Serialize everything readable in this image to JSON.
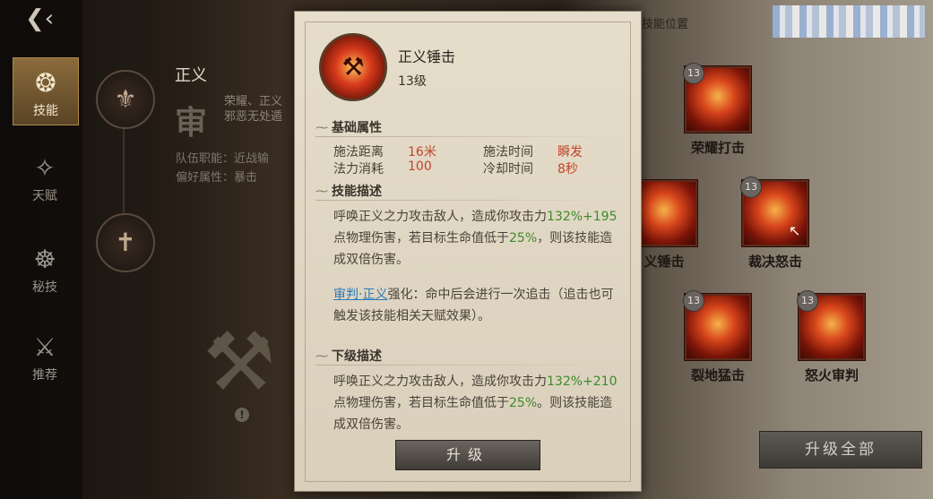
{
  "nav": {
    "back_icon": "back-arrow-icon",
    "items": [
      {
        "label": "技能",
        "icon": "skill-icon",
        "active": true
      },
      {
        "label": "天赋",
        "icon": "talent-icon",
        "active": false
      },
      {
        "label": "秘技",
        "icon": "secret-art-icon",
        "active": false
      },
      {
        "label": "推荐",
        "icon": "recommend-icon",
        "active": false
      }
    ]
  },
  "class_panel": {
    "name": "正义",
    "glyph": "审",
    "desc": "荣耀、正义 邪恶无处遁",
    "role": "队伍职能：近战输",
    "pref": "偏好属性：暴击"
  },
  "right": {
    "title": "技能位置",
    "skills": [
      {
        "name": "荣耀打击",
        "level": "13"
      },
      {
        "name": "义锤击",
        "level": ""
      },
      {
        "name": "裁决怒击",
        "level": "13"
      },
      {
        "name": "裂地猛击",
        "level": "13"
      },
      {
        "name": "怒火审判",
        "level": "13"
      }
    ],
    "upgrade_all": "升级全部"
  },
  "popup": {
    "skill_name": "正义锤击",
    "skill_level": "13级",
    "base_title": "基础属性",
    "stats": {
      "range_label": "施法距离",
      "range_value": "16米",
      "cast_label": "施法时间",
      "cast_value": "瞬发",
      "cost_label": "法力消耗",
      "cost_value": "100",
      "cd_label": "冷却时间",
      "cd_value": "8秒"
    },
    "desc_title": "技能描述",
    "desc": {
      "p1a": "呼唤正义之力攻击敌人，造成你攻击力",
      "p1b": "132%+195",
      "p1c": "点物理伤害，若目标生命值低于",
      "p1d": "25%",
      "p1e": "，则该技能造成双倍伤害。",
      "link": "审判·正义",
      "p2": "强化：命中后会进行一次追击（追击也可触发该技能相关天赋效果）。"
    },
    "next_title": "下级描述",
    "next": {
      "a": "呼唤正义之力攻击敌人，造成你攻击力",
      "b": "132%+210",
      "c": "点物理伤害，若目标生命值低于",
      "d": "25%",
      "e": "。则该技能造成双倍伤害。"
    },
    "upgrade": "升级"
  }
}
